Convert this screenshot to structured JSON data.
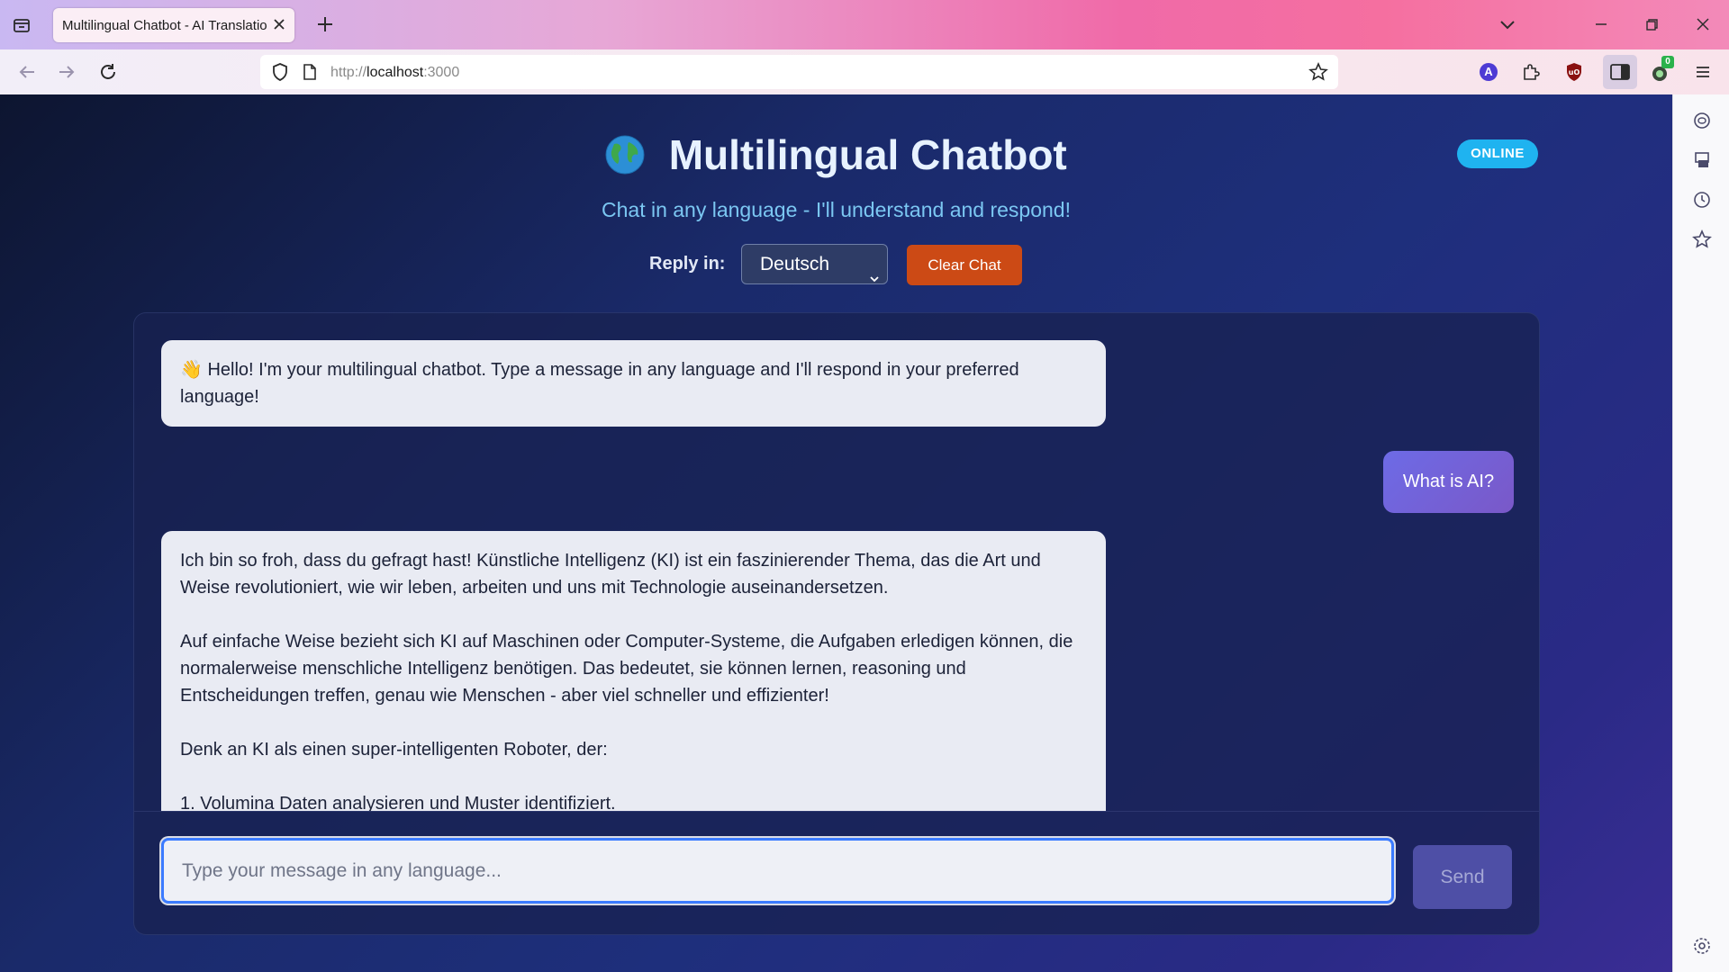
{
  "browser": {
    "tab_title": "Multilingual Chatbot - AI Translation",
    "url_prefix": "http://",
    "url_host": "localhost",
    "url_port": ":3000",
    "extension_badge": "0",
    "profile_letter": "A"
  },
  "header": {
    "title": "Multilingual Chatbot",
    "status_badge": "ONLINE",
    "subtitle": "Chat in any language - I'll understand and respond!"
  },
  "controls": {
    "reply_label": "Reply in:",
    "language_selected": "Deutsch",
    "clear_button": "Clear Chat"
  },
  "messages": {
    "bot_greeting": "👋 Hello! I'm your multilingual chatbot. Type a message in any language and I'll respond in your preferred language!",
    "user_question": "What is AI?",
    "bot_reply_p1": "Ich bin so froh, dass du gefragt hast! Künstliche Intelligenz (KI) ist ein faszinierender Thema, das die Art und Weise revolutioniert, wie wir leben, arbeiten und uns mit Technologie auseinandersetzen.",
    "bot_reply_p2": "Auf einfache Weise bezieht sich KI auf Maschinen oder Computer-Systeme, die Aufgaben erledigen können, die normalerweise menschliche Intelligenz benötigen. Das bedeutet, sie können lernen, reasoning und Entscheidungen treffen, genau wie Menschen - aber viel schneller und effizienter!",
    "bot_reply_p3": "Denk an KI als einen super-intelligenten Roboter, der:",
    "bot_reply_p4": "1. Volumina Daten analysieren und Muster identifiziert."
  },
  "composer": {
    "placeholder": "Type your message in any language...",
    "send_button": "Send"
  },
  "colors": {
    "accent_badge": "#1fb3f0",
    "clear_button": "#cc4a15",
    "user_bubble": "#6d6be6",
    "bot_bubble": "#e9ebf3"
  }
}
